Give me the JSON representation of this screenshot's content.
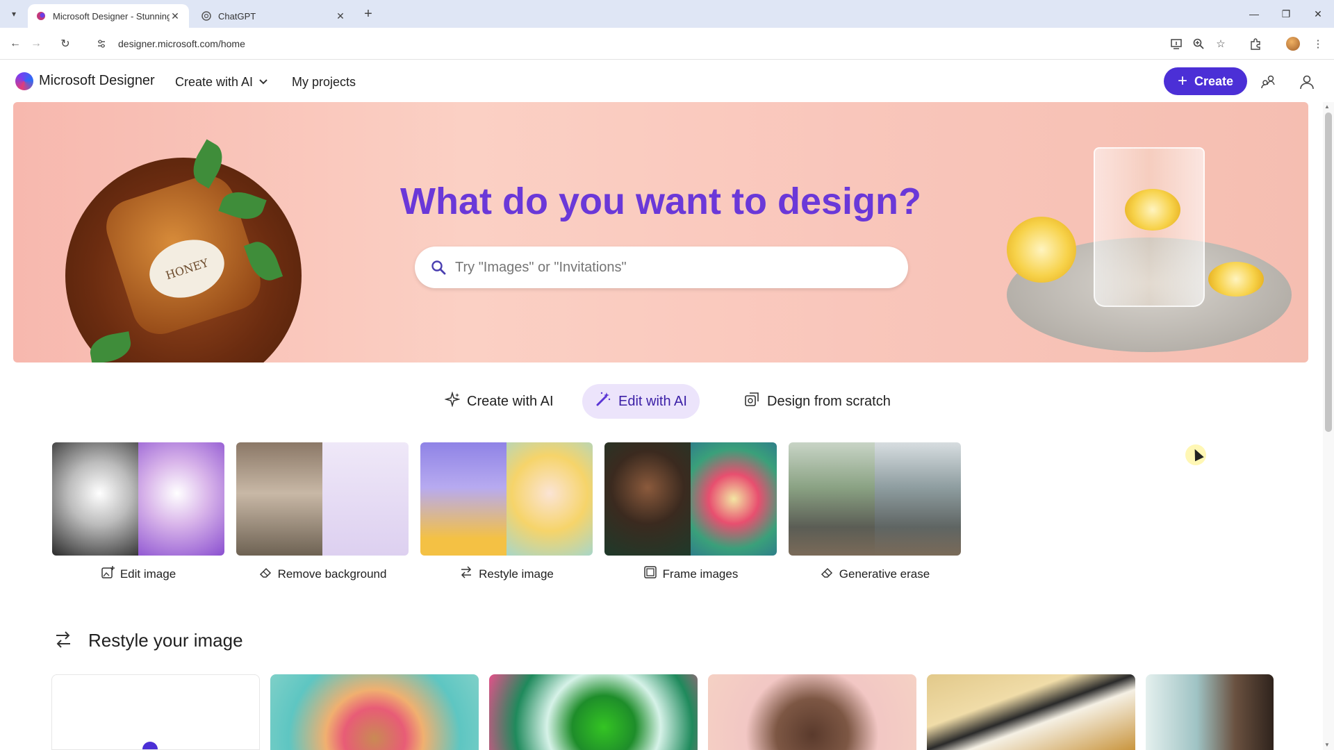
{
  "browser": {
    "tabs": [
      {
        "title": "Microsoft Designer - Stunning",
        "active": true
      },
      {
        "title": "ChatGPT",
        "active": false
      }
    ],
    "url": "designer.microsoft.com/home"
  },
  "header": {
    "brand": "Microsoft Designer",
    "nav": [
      {
        "label": "Create with AI"
      },
      {
        "label": "My projects"
      }
    ],
    "create_label": "Create"
  },
  "hero": {
    "title": "What do you want to design?",
    "search_placeholder": "Try \"Images\" or \"Invitations\"",
    "jar_label": "HONEY"
  },
  "modes": [
    {
      "label": "Create with AI",
      "icon": "sparkle-icon"
    },
    {
      "label": "Edit with AI",
      "icon": "magic-wand-icon",
      "selected": true
    },
    {
      "label": "Design from scratch",
      "icon": "design-icon"
    }
  ],
  "tools": [
    {
      "label": "Edit image",
      "icon": "image-edit-icon"
    },
    {
      "label": "Remove background",
      "icon": "eraser-icon"
    },
    {
      "label": "Restyle image",
      "icon": "swap-arrows-icon"
    },
    {
      "label": "Frame images",
      "icon": "frame-icon"
    },
    {
      "label": "Generative erase",
      "icon": "eraser-icon"
    }
  ],
  "section": {
    "title": "Restyle your image"
  },
  "colors": {
    "accent": "#4b2fd6",
    "hero_title": "#6a38d8",
    "selected_tab_bg": "#ece4fb"
  }
}
